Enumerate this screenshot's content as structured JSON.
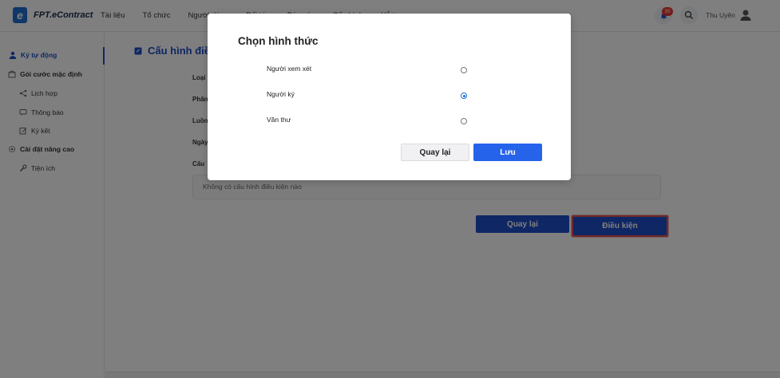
{
  "header": {
    "logo_letter": "e",
    "logo_text": "FPT.eContract",
    "nav": [
      "Tài liệu",
      "Tổ chức",
      "Người dùng",
      "Đối tác",
      "Báo cáo",
      "Cấu hình",
      "Hỗ trợ"
    ],
    "notification_count": "30",
    "username": "Thu Uyên"
  },
  "sidebar": {
    "items": [
      {
        "label": "Ký tự động",
        "icon": "user-icon"
      },
      {
        "label": "Gói cước mặc định",
        "icon": "package-icon"
      },
      {
        "label": "Lịch hợp",
        "icon": "share-icon"
      },
      {
        "label": "Thông báo",
        "icon": "message-icon"
      },
      {
        "label": "Ký kết",
        "icon": "edit-icon"
      },
      {
        "label": "Cài đặt nâng cao",
        "icon": "settings-icon"
      },
      {
        "label": "Tiện ích",
        "icon": "wrench-icon"
      }
    ]
  },
  "main": {
    "page_title": "Cấu hình điều kiện",
    "field_labels": [
      "Loại",
      "Phân",
      "Luồn",
      "Ngày",
      "Cấu"
    ],
    "empty_message": "Không có cấu hình điều kiện nào",
    "back_label": "Quay lại",
    "condition_label": "Điều kiện"
  },
  "modal": {
    "title": "Chọn hình thức",
    "options": [
      {
        "label": "Người xem xét",
        "selected": false
      },
      {
        "label": "Người ký",
        "selected": true
      },
      {
        "label": "Văn thư",
        "selected": false
      }
    ],
    "back_label": "Quay lại",
    "save_label": "Lưu"
  },
  "colors": {
    "primary": "#1f4fc8",
    "save_button": "#2563eb",
    "highlight_border": "#e05252",
    "badge": "#e53935"
  }
}
